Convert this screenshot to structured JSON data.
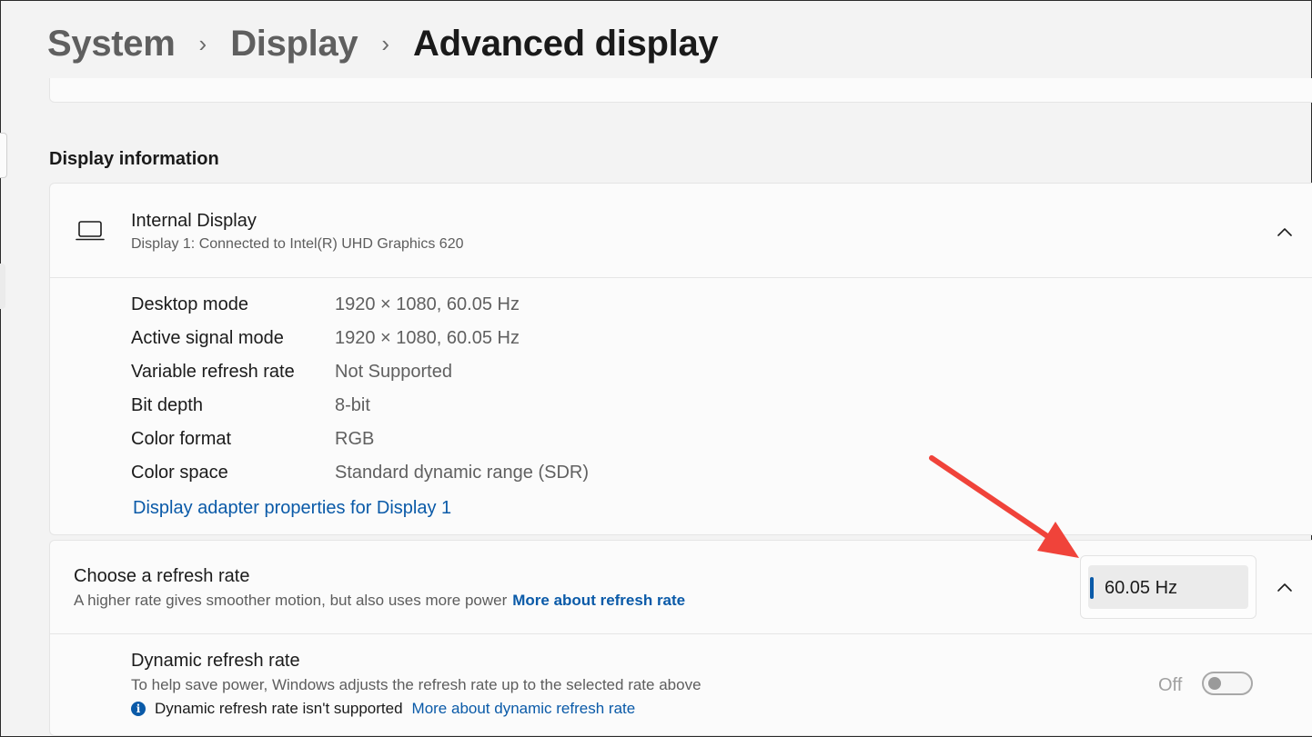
{
  "breadcrumb": {
    "items": [
      "System",
      "Display"
    ],
    "current": "Advanced display",
    "separator": "›"
  },
  "section": {
    "title": "Display information"
  },
  "display_card": {
    "title": "Internal Display",
    "subtitle": "Display 1: Connected to Intel(R) UHD Graphics 620",
    "icon": "laptop-icon",
    "rows": [
      {
        "label": "Desktop mode",
        "value": "1920 × 1080, 60.05 Hz"
      },
      {
        "label": "Active signal mode",
        "value": "1920 × 1080, 60.05 Hz"
      },
      {
        "label": "Variable refresh rate",
        "value": "Not Supported"
      },
      {
        "label": "Bit depth",
        "value": "8-bit"
      },
      {
        "label": "Color format",
        "value": "RGB"
      },
      {
        "label": "Color space",
        "value": "Standard dynamic range (SDR)"
      }
    ],
    "adapter_link": "Display adapter properties for Display 1"
  },
  "refresh_card": {
    "title": "Choose a refresh rate",
    "description": "A higher rate gives smoother motion, but also uses more power",
    "more_link": "More about refresh rate",
    "selected_rate": "60.05 Hz"
  },
  "dynamic_refresh": {
    "title": "Dynamic refresh rate",
    "description": "To help save power, Windows adjusts the refresh rate up to the selected rate above",
    "note": "Dynamic refresh rate isn't supported",
    "note_link": "More about dynamic refresh rate",
    "toggle_state_label": "Off",
    "toggle_on": false
  },
  "colors": {
    "accent": "#0a5aa8",
    "annotation_arrow": "#f0433a",
    "background": "#f3f3f3",
    "card": "#fbfbfb"
  }
}
